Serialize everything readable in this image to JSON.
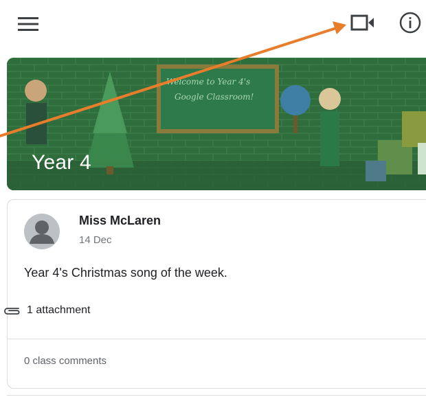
{
  "topbar": {
    "icons": [
      "menu-icon",
      "video-icon",
      "info-icon"
    ]
  },
  "banner": {
    "title": "Year 4",
    "board_line1": "Welcome to Year 4's",
    "board_line2": "Google Classroom!",
    "color": "#2e6b3c"
  },
  "post": {
    "author": "Miss McLaren",
    "date": "14 Dec",
    "text": "Year 4's Christmas song of the week.",
    "attachment_label": "1 attachment",
    "comments_label": "0 class comments"
  },
  "annotation": {
    "arrow_color": "#e87d2b"
  }
}
